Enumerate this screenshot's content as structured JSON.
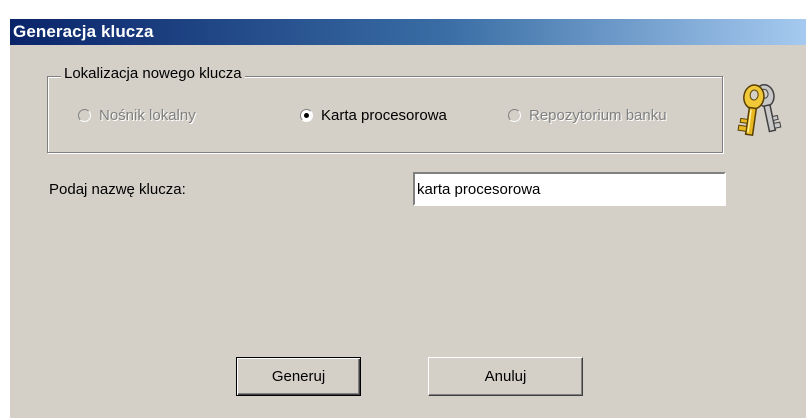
{
  "window": {
    "title": "Generacja klucza"
  },
  "location_group": {
    "legend": "Lokalizacja nowego klucza",
    "options": [
      {
        "label": "Nośnik lokalny",
        "selected": false,
        "enabled": false
      },
      {
        "label": "Karta procesorowa",
        "selected": true,
        "enabled": true
      },
      {
        "label": "Repozytorium banku",
        "selected": false,
        "enabled": false
      }
    ]
  },
  "key_name": {
    "label": "Podaj nazwę klucza:",
    "value": "karta procesorowa"
  },
  "buttons": {
    "generate_label": "Generuj",
    "cancel_label": "Anuluj"
  },
  "icons": {
    "keys": "keys-icon"
  },
  "colors": {
    "titlebar_start": "#0a246a",
    "titlebar_end": "#a6caf0",
    "dialog_face": "#d4d0c8"
  }
}
